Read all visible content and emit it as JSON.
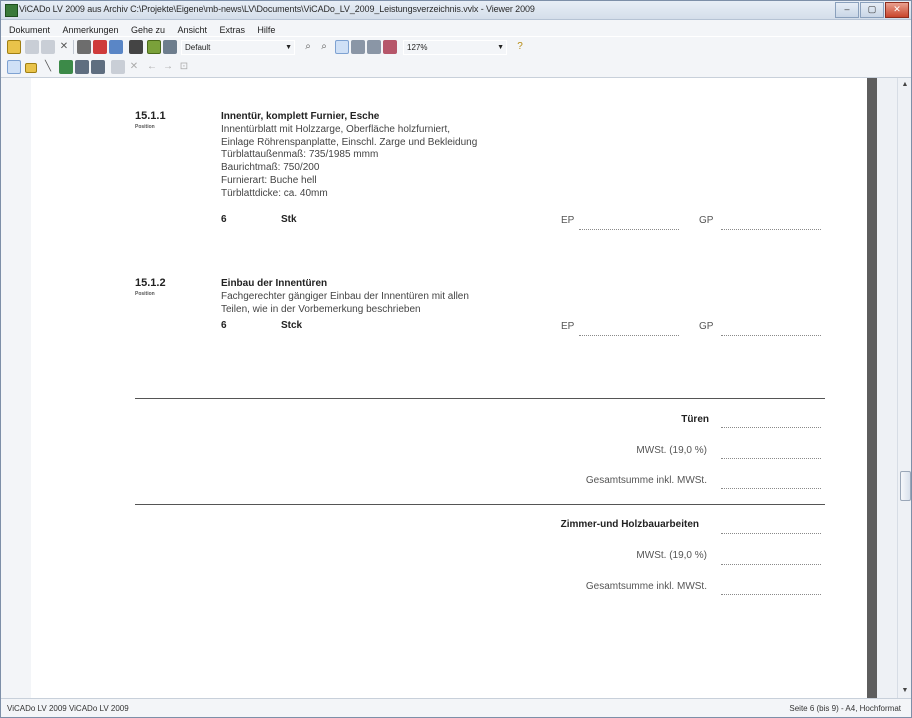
{
  "window": {
    "title": "ViCADo LV 2009 aus Archiv C:\\Projekte\\Eigene\\mb-news\\LV\\Documents\\ViCADo_LV_2009_Leistungsverzeichnis.vvlx - Viewer 2009",
    "controls": {
      "minimize": "–",
      "maximize": "▢",
      "close": "✕"
    }
  },
  "menu": [
    "Dokument",
    "Anmerkungen",
    "Gehe zu",
    "Ansicht",
    "Extras",
    "Hilfe"
  ],
  "toolbar": {
    "style_select": "Default",
    "zoom_select": "127%"
  },
  "document": {
    "positions": [
      {
        "number": "15.1.1",
        "sub": "Position",
        "title": "Innentür, komplett Furnier, Esche",
        "lines": [
          "Innentürblatt mit Holzzarge, Oberfläche holzfurniert,",
          "Einlage Röhrenspanplatte, Einschl. Zarge und Bekleidung",
          "Türblattaußenmaß: 735/1985 mmm",
          "Baurichtmaß: 750/200",
          "Furnierart: Buche hell",
          "Türblattdicke: ca. 40mm"
        ],
        "qty": "6",
        "unit": "Stk",
        "ep_label": "EP",
        "gp_label": "GP"
      },
      {
        "number": "15.1.2",
        "sub": "Position",
        "title": "Einbau der Innentüren",
        "lines": [
          "Fachgerechter gängiger Einbau der Innentüren mit allen",
          "Teilen, wie in der Vorbemerkung beschrieben"
        ],
        "qty": "6",
        "unit": "Stck",
        "ep_label": "EP",
        "gp_label": "GP"
      }
    ],
    "summary1": {
      "title": "Türen",
      "vat": "MWSt. (19,0 %)",
      "total": "Gesamtsumme inkl. MWSt."
    },
    "summary2": {
      "title": "Zimmer-und Holzbauarbeiten",
      "vat": "MWSt. (19,0 %)",
      "total": "Gesamtsumme inkl. MWSt."
    }
  },
  "status": {
    "left": "ViCADo LV 2009 ViCADo LV 2009",
    "right": "Seite 6 (bis 9) - A4, Hochformat"
  }
}
